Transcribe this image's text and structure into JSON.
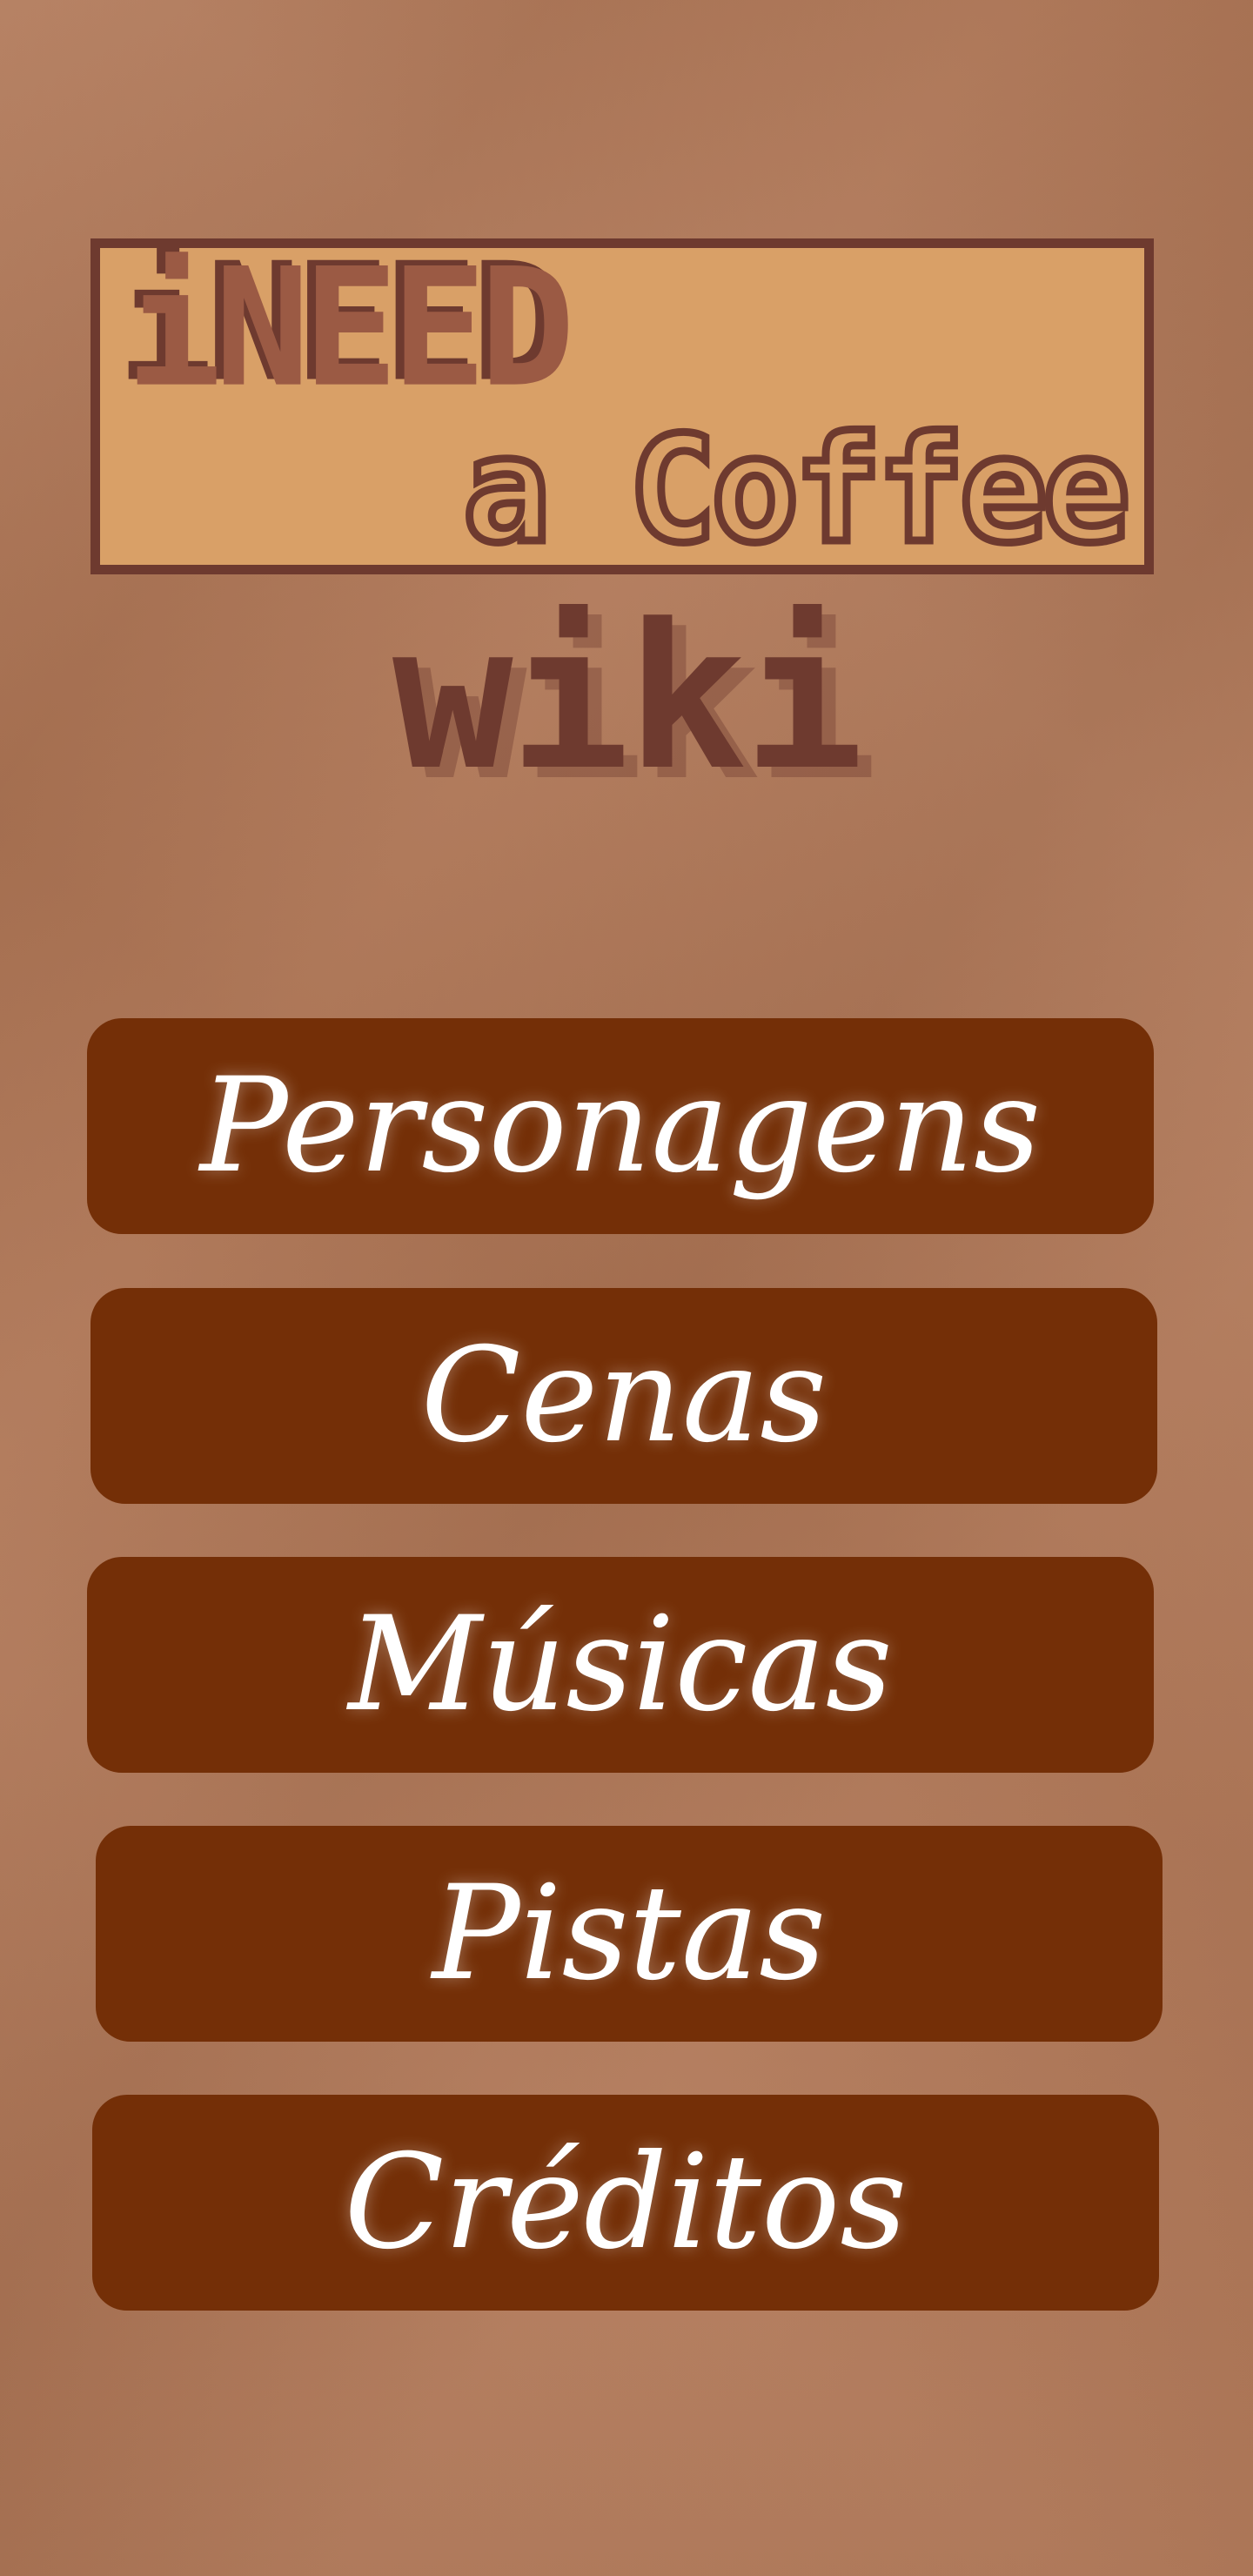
{
  "logo": {
    "line1": "iNEED",
    "line2": "a Coffee",
    "subtitle": "wiki"
  },
  "menu": {
    "items": [
      {
        "label": "Personagens"
      },
      {
        "label": "Cenas"
      },
      {
        "label": "Músicas"
      },
      {
        "label": "Pistas"
      },
      {
        "label": "Créditos"
      }
    ]
  },
  "colors": {
    "background": "#b07655",
    "logo_fill": "#d9a067",
    "logo_ink": "#6e3a2f",
    "button": "#742f07",
    "button_text": "#ffffff"
  }
}
